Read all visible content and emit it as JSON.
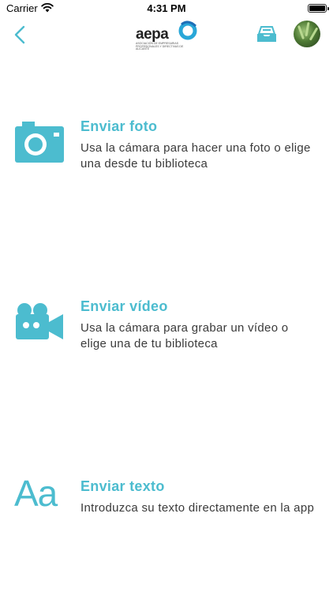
{
  "status_bar": {
    "carrier": "Carrier",
    "time": "4:31 PM"
  },
  "nav": {
    "back_icon": "chevron-left-icon",
    "logo_text": "aepa",
    "logo_tagline": "ASOCIACIÓN DE EMPRESARIAS PROFESIONALES Y DIRECTIVAS DE ALICANTE",
    "inbox_icon": "inbox-tray-icon",
    "avatar": "user-avatar"
  },
  "colors": {
    "accent": "#4cbccf",
    "text": "#3a3a3a"
  },
  "options": [
    {
      "title": "Enviar foto",
      "description": "Usa la cámara para hacer una foto o elige una desde tu biblioteca",
      "icon": "camera-icon"
    },
    {
      "title": "Enviar vídeo",
      "description": "Usa la cámara para grabar un vídeo o elige una de tu biblioteca",
      "icon": "video-camera-icon"
    },
    {
      "title": "Enviar texto",
      "description": "Introduzca su texto directamente en la app",
      "icon": "text-aa-icon",
      "icon_glyph": "Aa"
    }
  ]
}
